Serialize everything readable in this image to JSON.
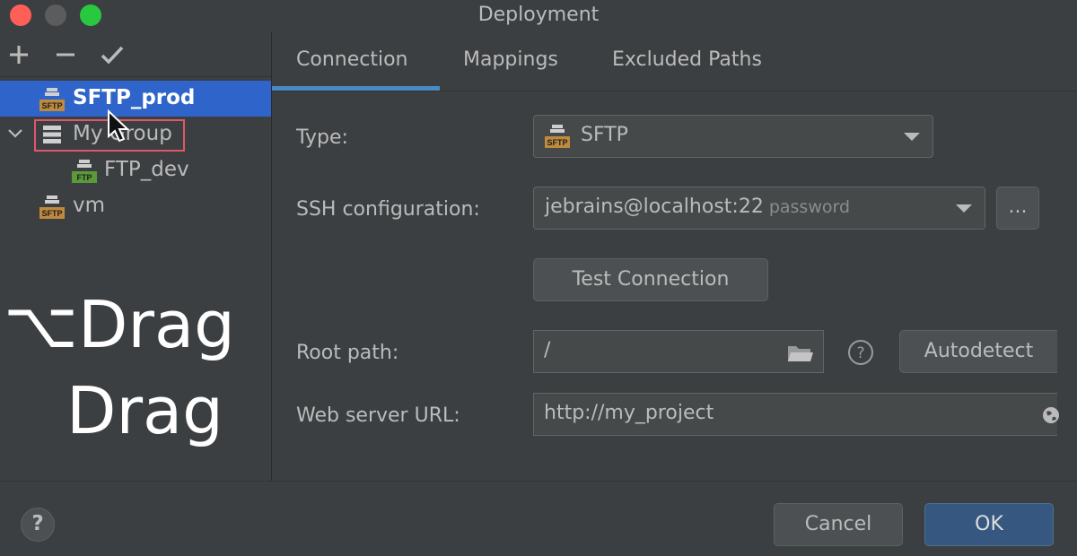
{
  "window": {
    "title": "Deployment"
  },
  "toolbar": {
    "add": "add",
    "remove": "remove",
    "apply": "apply"
  },
  "tree": {
    "items": [
      {
        "label": "SFTP_prod",
        "badge": "SFTP",
        "selected": true
      },
      {
        "label": "My Group",
        "expanded": true,
        "group": true
      },
      {
        "label": "FTP_dev",
        "badge": "FTP"
      },
      {
        "label": "vm",
        "badge": "SFTP"
      }
    ]
  },
  "overlay": {
    "line1": "⌥Drag",
    "line2": "Drag"
  },
  "tabs": [
    {
      "label": "Connection",
      "active": true
    },
    {
      "label": "Mappings"
    },
    {
      "label": "Excluded Paths"
    }
  ],
  "form": {
    "type_label": "Type:",
    "type_value": "SFTP",
    "type_badge": "SFTP",
    "ssh_label": "SSH configuration:",
    "ssh_value": "jebrains@localhost:22",
    "ssh_hint": "password",
    "ssh_more": "...",
    "test_connection": "Test Connection",
    "root_label": "Root path:",
    "root_value": "/",
    "help_q": "?",
    "autodetect": "Autodetect",
    "web_label": "Web server URL:",
    "web_value": "http://my_project"
  },
  "footer": {
    "help": "?",
    "cancel": "Cancel",
    "ok": "OK"
  },
  "colors": {
    "selection": "#2f65ca",
    "accent_tab": "#4a88c7",
    "ok_button": "#365880",
    "sftp_badge": "#c08a3e",
    "ftp_badge": "#5a9a3a",
    "group_outline": "#e0566b"
  }
}
